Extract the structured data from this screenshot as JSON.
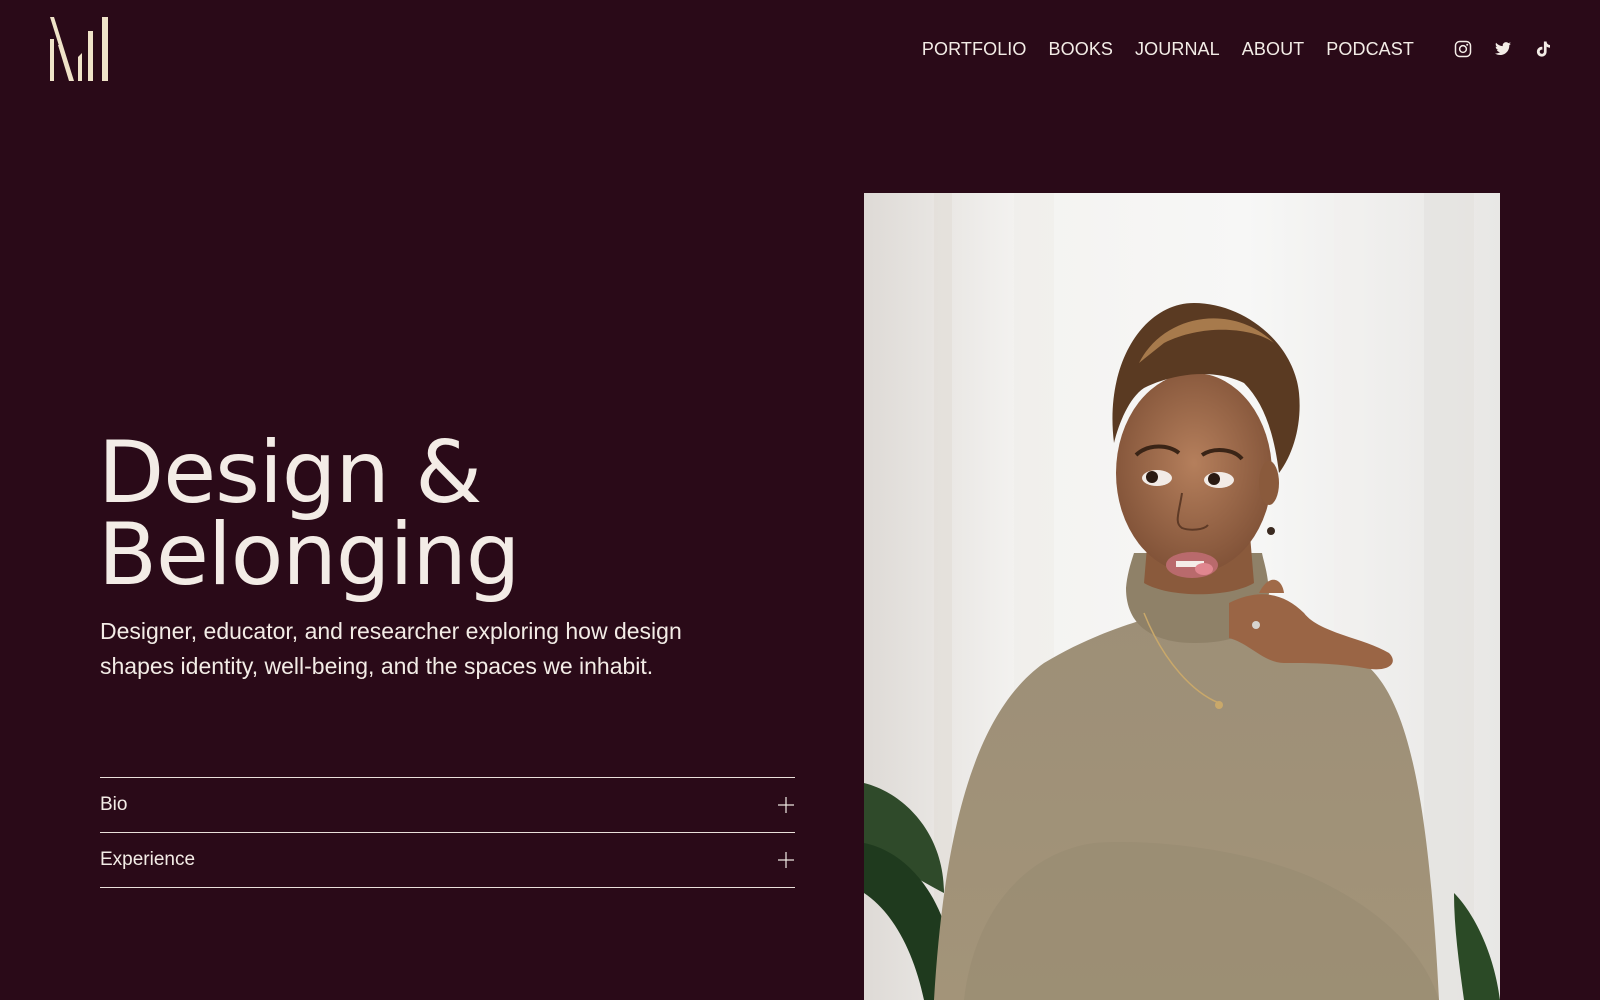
{
  "header": {
    "logo_name": "monogram-logo",
    "nav": [
      {
        "label": "PORTFOLIO"
      },
      {
        "label": "BOOKS"
      },
      {
        "label": "JOURNAL"
      },
      {
        "label": "ABOUT"
      },
      {
        "label": "PODCAST"
      }
    ],
    "social": [
      {
        "icon": "instagram-icon"
      },
      {
        "icon": "twitter-icon"
      },
      {
        "icon": "tiktok-icon"
      }
    ]
  },
  "hero": {
    "title_line1": "Design &",
    "title_line2": "Belonging",
    "subtitle": "Designer, educator, and researcher exploring how design shapes identity, well-being, and the spaces we inhabit."
  },
  "accordion": {
    "items": [
      {
        "label": "Bio",
        "icon": "plus-icon"
      },
      {
        "label": "Experience",
        "icon": "plus-icon"
      }
    ]
  },
  "photo": {
    "subject": "portrait-photo"
  },
  "colors": {
    "background": "#2a0a18",
    "text": "#f3ece6",
    "logo": "#efe3c8"
  }
}
